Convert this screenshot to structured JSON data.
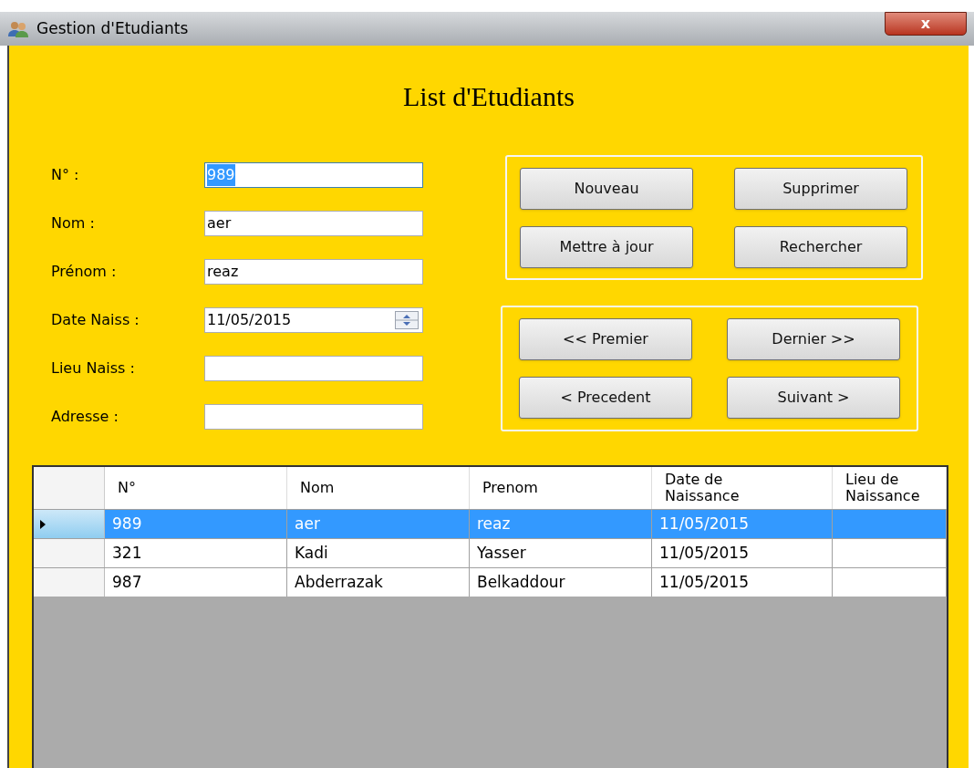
{
  "window": {
    "title": "Gestion d'Etudiants",
    "close": "x"
  },
  "heading": "List d'Etudiants",
  "fields": [
    {
      "kind": "text",
      "label": "N° :",
      "value": "989",
      "focused": true
    },
    {
      "kind": "text",
      "label": "Nom :",
      "value": "aer",
      "focused": false
    },
    {
      "kind": "text",
      "label": "Prénom :",
      "value": "reaz",
      "focused": false
    },
    {
      "kind": "date",
      "label": "Date Naiss :",
      "value": "11/05/2015",
      "focused": false
    },
    {
      "kind": "text",
      "label": "Lieu Naiss :",
      "focused": false
    },
    {
      "kind": "text",
      "label": "Adresse :",
      "focused": false
    }
  ],
  "action_buttons": [
    "Nouveau",
    "Supprimer",
    "Mettre à jour",
    "Rechercher"
  ],
  "navigation_buttons": [
    "<< Premier",
    "Dernier >>",
    "< Precedent",
    "Suivant >"
  ],
  "table": {
    "columns": [
      "N°",
      "Nom",
      "Prenom",
      "Date de Naissance",
      "Lieu de Naissance"
    ],
    "rows": [
      {
        "cells": [
          "989",
          "aer",
          "reaz",
          "11/05/2015"
        ],
        "selected": true
      },
      {
        "cells": [
          "321",
          "Kadi",
          "Yasser",
          "11/05/2015"
        ],
        "selected": false
      },
      {
        "cells": [
          "987",
          "Abderrazak",
          "Belkaddour",
          "11/05/2015"
        ],
        "selected": false
      }
    ]
  }
}
